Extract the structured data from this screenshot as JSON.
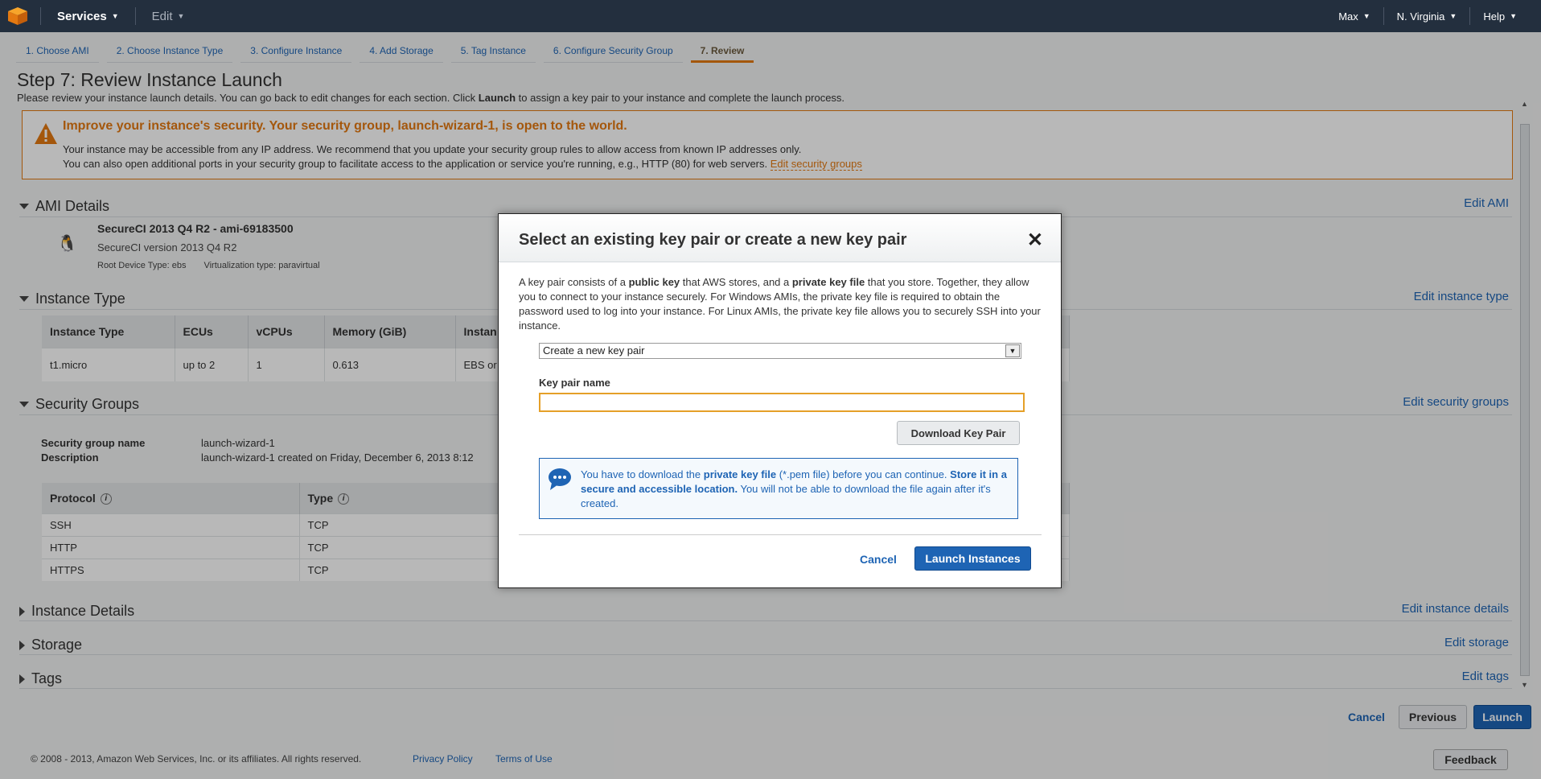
{
  "topnav": {
    "services_label": "Services",
    "edit_label": "Edit",
    "user_label": "Max",
    "region_label": "N. Virginia",
    "help_label": "Help"
  },
  "wizard_tabs": [
    {
      "label": "1. Choose AMI"
    },
    {
      "label": "2. Choose Instance Type"
    },
    {
      "label": "3. Configure Instance"
    },
    {
      "label": "4. Add Storage"
    },
    {
      "label": "5. Tag Instance"
    },
    {
      "label": "6. Configure Security Group"
    },
    {
      "label": "7. Review"
    }
  ],
  "page": {
    "title": "Step 7: Review Instance Launch",
    "intro_pre": "Please review your instance launch details. You can go back to edit changes for each section. Click ",
    "intro_bold": "Launch",
    "intro_post": " to assign a key pair to your instance and complete the launch process."
  },
  "warning": {
    "title": "Improve your instance's security. Your security group, launch-wizard-1, is open to the world.",
    "line1": "Your instance may be accessible from any IP address. We recommend that you update your security group rules to allow access from known IP addresses only.",
    "line2": "You can also open additional ports in your security group to facilitate access to the application or service you're running, e.g., HTTP (80) for web servers. ",
    "link": "Edit security groups"
  },
  "ami": {
    "heading": "AMI Details",
    "edit": "Edit AMI",
    "name": "SecureCI 2013 Q4 R2 - ami-69183500",
    "version": "SecureCI version 2013 Q4 R2",
    "root_device": "Root Device Type: ebs",
    "virtualization": "Virtualization type: paravirtual"
  },
  "instance_type": {
    "heading": "Instance Type",
    "edit": "Edit instance type",
    "columns": [
      "Instance Type",
      "ECUs",
      "vCPUs",
      "Memory (GiB)",
      "Instan"
    ],
    "row": [
      "t1.micro",
      "up to 2",
      "1",
      "0.613",
      "EBS or"
    ]
  },
  "security_groups": {
    "heading": "Security Groups",
    "edit": "Edit security groups",
    "name_label": "Security group name",
    "name_value": "launch-wizard-1",
    "desc_label": "Description",
    "desc_value": "launch-wizard-1 created on Friday, December 6, 2013 8:12",
    "columns": [
      "Protocol",
      "Type"
    ],
    "rows": [
      [
        "SSH",
        "TCP"
      ],
      [
        "HTTP",
        "TCP"
      ],
      [
        "HTTPS",
        "TCP"
      ]
    ]
  },
  "collapsed_sections": {
    "instance_details": {
      "heading": "Instance Details",
      "edit": "Edit instance details"
    },
    "storage": {
      "heading": "Storage",
      "edit": "Edit storage"
    },
    "tags": {
      "heading": "Tags",
      "edit": "Edit tags"
    }
  },
  "bottom_buttons": {
    "cancel": "Cancel",
    "previous": "Previous",
    "launch": "Launch"
  },
  "footer": {
    "copyright": "© 2008 - 2013, Amazon Web Services, Inc. or its affiliates. All rights reserved.",
    "privacy": "Privacy Policy",
    "terms": "Terms of Use",
    "feedback": "Feedback"
  },
  "modal": {
    "title": "Select an existing key pair or create a new key pair",
    "desc_1": "A key pair consists of a ",
    "desc_b1": "public key",
    "desc_2": " that AWS stores, and a ",
    "desc_b2": "private key file",
    "desc_3": " that you store. Together, they allow you to connect to your instance securely. For Windows AMIs, the private key file is required to obtain the password used to log into your instance. For Linux AMIs, the private key file allows you to securely SSH into your instance.",
    "select_value": "Create a new key pair",
    "key_name_label": "Key pair name",
    "key_name_value": "",
    "download_label": "Download Key Pair",
    "info_1": "You have to download the ",
    "info_b1": "private key file",
    "info_2": " (*.pem file) before you can continue. ",
    "info_b2": "Store it in a secure and accessible location.",
    "info_3": " You will not be able to download the file again after it's created.",
    "cancel_label": "Cancel",
    "launch_label": "Launch Instances"
  },
  "colors": {
    "nav_bg": "#232f3e",
    "accent_orange": "#e47911",
    "link_blue": "#1e64b4"
  }
}
